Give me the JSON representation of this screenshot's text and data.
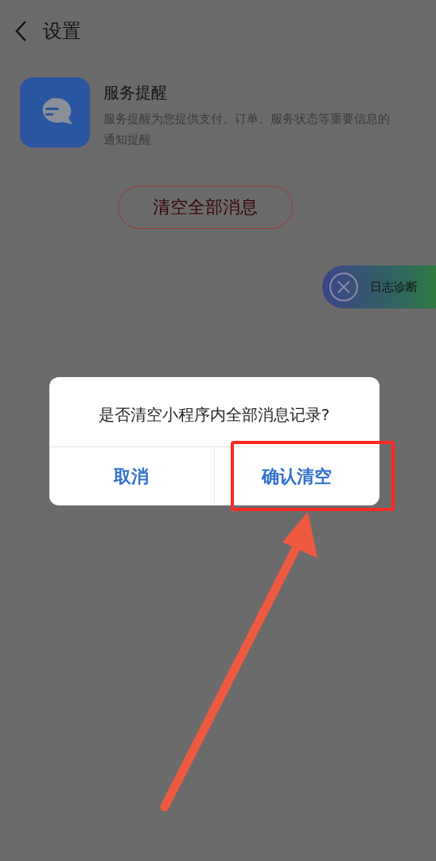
{
  "header": {
    "title": "设置"
  },
  "service": {
    "title": "服务提醒",
    "description": "服务提醒为您提供支付、订单、服务状态等重要信息的通知提醒"
  },
  "clear_button": {
    "label": "清空全部消息"
  },
  "float_button": {
    "label": "日志诊断"
  },
  "dialog": {
    "message": "是否清空小程序内全部消息记录?",
    "buttons": [
      {
        "label": "取消"
      },
      {
        "label": "确认清空"
      }
    ]
  },
  "annotations": {
    "highlight_box": true,
    "arrow": true
  }
}
